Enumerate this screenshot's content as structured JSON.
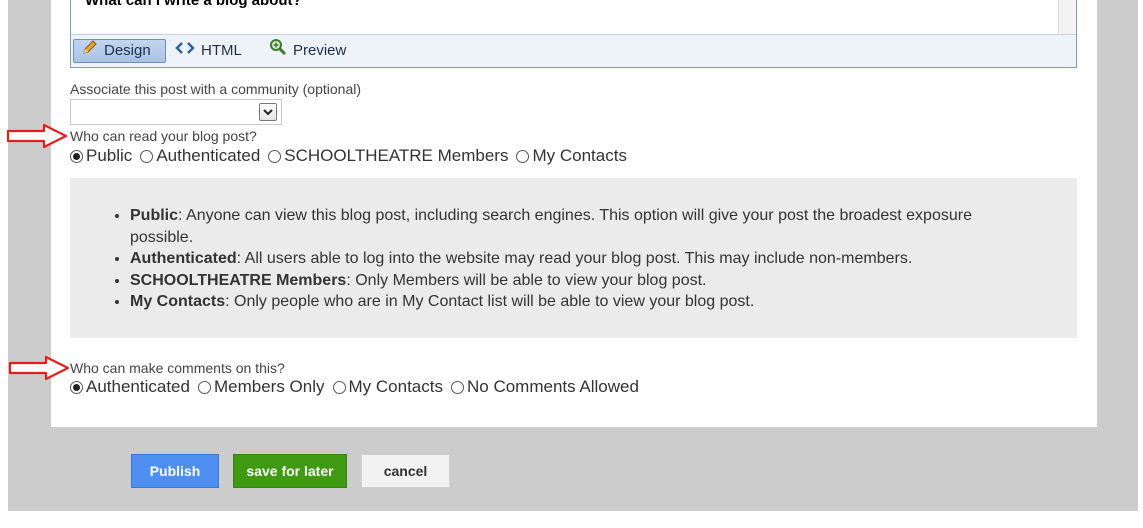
{
  "editor": {
    "content_text": "What can I write a blog about?",
    "tabs": [
      {
        "label": "Design",
        "icon": "pencil-icon",
        "active": true
      },
      {
        "label": "HTML",
        "icon": "code-icon",
        "active": false
      },
      {
        "label": "Preview",
        "icon": "magnifier-icon",
        "active": false
      }
    ]
  },
  "community": {
    "label": "Associate this post with a community (optional)",
    "selected": ""
  },
  "read_access": {
    "question": "Who can read your blog post?",
    "options": [
      "Public",
      "Authenticated",
      "SCHOOLTHEATRE Members",
      "My Contacts"
    ],
    "selected": "Public"
  },
  "info": {
    "items": [
      {
        "term": "Public",
        "desc": ": Anyone can view this blog post, including search engines. This option will give your post the broadest exposure possible."
      },
      {
        "term": "Authenticated",
        "desc": ": All users able to log into the website may read your blog post. This may include non-members."
      },
      {
        "term": "SCHOOLTHEATRE Members",
        "desc": ": Only Members will be able to view your blog post."
      },
      {
        "term": "My Contacts",
        "desc": ": Only people who are in My Contact list will be able to view your blog post."
      }
    ]
  },
  "comment_access": {
    "question": "Who can make comments on this?",
    "options": [
      "Authenticated",
      "Members Only",
      "My Contacts",
      "No Comments Allowed"
    ],
    "selected": "Authenticated"
  },
  "actions": {
    "publish_label": "Publish",
    "save_label": "save for later",
    "cancel_label": "cancel"
  },
  "colors": {
    "annotation_arrow": "#e02020",
    "publish": "#4e8ef0",
    "save": "#3f9a12"
  }
}
